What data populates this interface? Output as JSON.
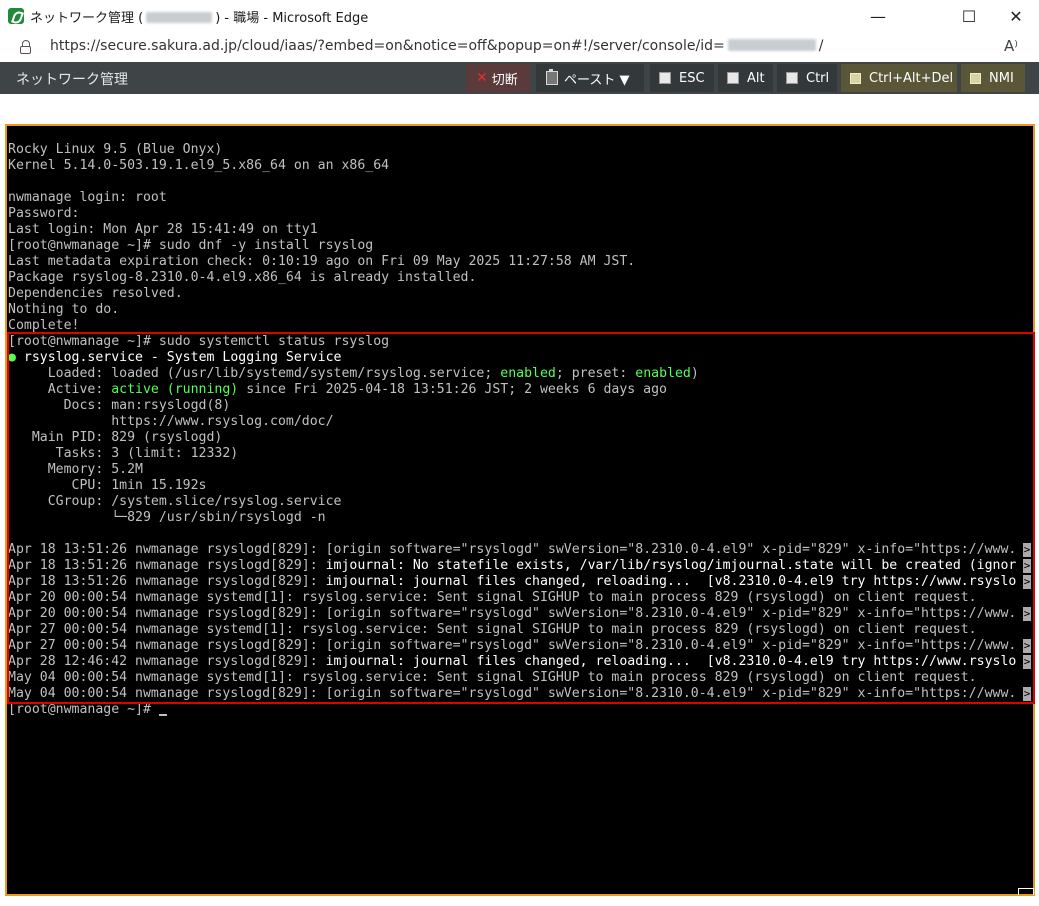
{
  "window": {
    "title_prefix": "ネットワーク管理 (",
    "title_suffix": ") - 職場 - Microsoft Edge",
    "minimize_glyph": "—",
    "maximize_glyph": "☐",
    "close_glyph": "✕"
  },
  "address": {
    "url_prefix": "https://secure.sakura.ad.jp/cloud/iaas/?embed=on&notice=off&popup=on#!/server/console/id=",
    "url_suffix": "/",
    "read_aloud": "A⁾"
  },
  "toolbar": {
    "title": "ネットワーク管理",
    "disconnect_label": "切断",
    "paste_label": "ペースト ▼",
    "esc_label": "ESC",
    "alt_label": "Alt",
    "ctrl_label": "Ctrl",
    "ctrl_alt_del_label": "Ctrl+Alt+Del",
    "nmi_label": "NMI"
  },
  "terminal": {
    "l1": "Rocky Linux 9.5 (Blue Onyx)",
    "l2": "Kernel 5.14.0-503.19.1.el9_5.x86_64 on an x86_64",
    "l3": "",
    "l4": "nwmanage login: root",
    "l5": "Password:",
    "l6": "Last login: Mon Apr 28 15:41:49 on tty1",
    "l7": "[root@nwmanage ~]# sudo dnf -y install rsyslog",
    "l8": "Last metadata expiration check: 0:10:19 ago on Fri 09 May 2025 11:27:58 AM JST.",
    "l9": "Package rsyslog-8.2310.0-4.el9.x86_64 is already installed.",
    "l10": "Dependencies resolved.",
    "l11": "Nothing to do.",
    "l12": "Complete!",
    "l13": "[root@nwmanage ~]# sudo systemctl status rsyslog",
    "l14_dot": "●",
    "l14": " rsyslog.service - System Logging Service",
    "l15_a": "     Loaded: loaded (/usr/lib/systemd/system/rsyslog.service; ",
    "l15_b": "enabled",
    "l15_c": "; preset: ",
    "l15_d": "enabled",
    "l15_e": ")",
    "l16_a": "     Active: ",
    "l16_b": "active (running)",
    "l16_c": " since Fri 2025-04-18 13:51:26 JST; 2 weeks 6 days ago",
    "l17": "       Docs: man:rsyslogd(8)",
    "l18": "             https://www.rsyslog.com/doc/",
    "l19": "   Main PID: 829 (rsyslogd)",
    "l20": "      Tasks: 3 (limit: 12332)",
    "l21": "     Memory: 5.2M",
    "l22": "        CPU: 1min 15.192s",
    "l23": "     CGroup: /system.slice/rsyslog.service",
    "l24": "             └─829 /usr/sbin/rsyslogd -n",
    "l25": "",
    "l26": "Apr 18 13:51:26 nwmanage rsyslogd[829]: [origin software=\"rsyslogd\" swVersion=\"8.2310.0-4.el9\" x-pid=\"829\" x-info=\"https://www.",
    "l27_a": "Apr 18 13:51:26 nwmanage rsyslogd[829]: ",
    "l27_b": "imjournal: No statefile exists, /var/lib/rsyslog/imjournal.state will be created (ignor",
    "l28_a": "Apr 18 13:51:26 nwmanage rsyslogd[829]: ",
    "l28_b": "imjournal: journal files changed, reloading...  [v8.2310.0-4.el9 try https://www.rsyslo",
    "l29": "Apr 20 00:00:54 nwmanage systemd[1]: rsyslog.service: Sent signal SIGHUP to main process 829 (rsyslogd) on client request.",
    "l30": "Apr 20 00:00:54 nwmanage rsyslogd[829]: [origin software=\"rsyslogd\" swVersion=\"8.2310.0-4.el9\" x-pid=\"829\" x-info=\"https://www.",
    "l31": "Apr 27 00:00:54 nwmanage systemd[1]: rsyslog.service: Sent signal SIGHUP to main process 829 (rsyslogd) on client request.",
    "l32": "Apr 27 00:00:54 nwmanage rsyslogd[829]: [origin software=\"rsyslogd\" swVersion=\"8.2310.0-4.el9\" x-pid=\"829\" x-info=\"https://www.",
    "l33_a": "Apr 28 12:46:42 nwmanage rsyslogd[829]: ",
    "l33_b": "imjournal: journal files changed, reloading...  [v8.2310.0-4.el9 try https://www.rsyslo",
    "l34": "May 04 00:00:54 nwmanage systemd[1]: rsyslog.service: Sent signal SIGHUP to main process 829 (rsyslogd) on client request.",
    "l35": "May 04 00:00:54 nwmanage rsyslogd[829]: [origin software=\"rsyslogd\" swVersion=\"8.2310.0-4.el9\" x-pid=\"829\" x-info=\"https://www.",
    "l36": "[root@nwmanage ~]# ",
    "trunc": ">"
  },
  "colors": {
    "terminal_border": "#e69a1e",
    "highlight_box": "#e00000",
    "enabled_green": "#55ff55"
  }
}
